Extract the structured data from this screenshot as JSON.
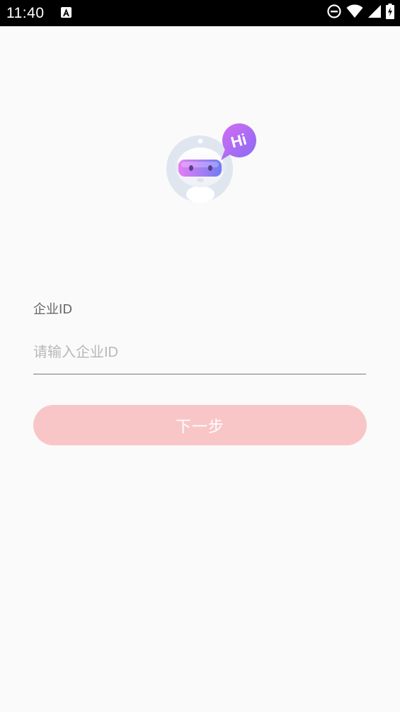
{
  "status_bar": {
    "time": "11:40",
    "icons": [
      "text-a-icon",
      "do-not-disturb-icon",
      "wifi-icon",
      "signal-icon",
      "battery-charging-icon"
    ]
  },
  "logo": {
    "bubble_text": "Hi",
    "icon": "robot-mascot-icon"
  },
  "form": {
    "label": "企业ID",
    "input_value": "",
    "input_placeholder": "请输入企业ID",
    "next_button_label": "下一步"
  },
  "colors": {
    "background": "#fafafa",
    "button": "#f9c6c7",
    "bubble_start": "#c764f2",
    "bubble_end": "#8a6cf5"
  }
}
